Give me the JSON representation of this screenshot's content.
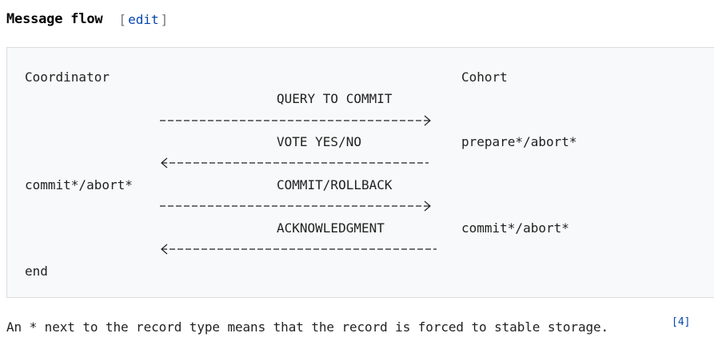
{
  "section": {
    "title": "Message flow",
    "edit_open": "[",
    "edit_label": "edit",
    "edit_close": "]"
  },
  "flow": {
    "coordinator_header": "Coordinator",
    "cohort_header": "Cohort",
    "msg_query": "QUERY TO COMMIT",
    "msg_vote": "VOTE YES/NO",
    "msg_commit": "COMMIT/ROLLBACK",
    "msg_ack": "ACKNOWLEDGMENT",
    "cohort_prepare": "prepare*/abort*",
    "coordinator_commit": "commit*/abort*",
    "cohort_commit": "commit*/abort*",
    "coordinator_end": "end"
  },
  "footnote": {
    "text": "An * next to the record type means that the record is forced to stable storage.",
    "ref_label": "[4]"
  }
}
